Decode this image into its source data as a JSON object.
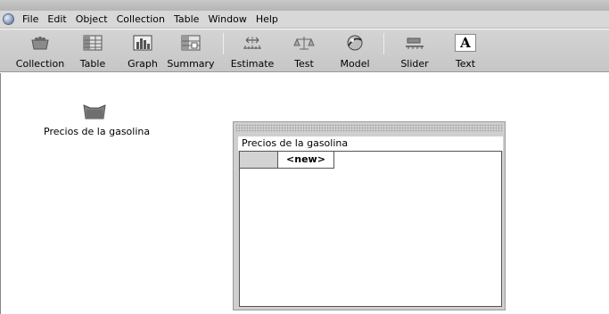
{
  "menu": {
    "items": [
      "File",
      "Edit",
      "Object",
      "Collection",
      "Table",
      "Window",
      "Help"
    ]
  },
  "toolbar": {
    "tools": [
      {
        "label": "Collection",
        "icon": "collection-icon"
      },
      {
        "label": "Table",
        "icon": "table-icon"
      },
      {
        "label": "Graph",
        "icon": "graph-icon"
      },
      {
        "label": "Summary",
        "icon": "summary-icon"
      },
      {
        "label": "Estimate",
        "icon": "estimate-icon"
      },
      {
        "label": "Test",
        "icon": "test-icon"
      },
      {
        "label": "Model",
        "icon": "model-icon"
      },
      {
        "label": "Slider",
        "icon": "slider-icon"
      },
      {
        "label": "Text",
        "icon": "text-icon"
      }
    ],
    "text_tool_glyph": "A"
  },
  "workspace": {
    "collection": {
      "label": "Precios de la gasolina"
    },
    "case_table": {
      "title": "Precios de la gasolina",
      "new_attribute_label": "<new>"
    }
  }
}
